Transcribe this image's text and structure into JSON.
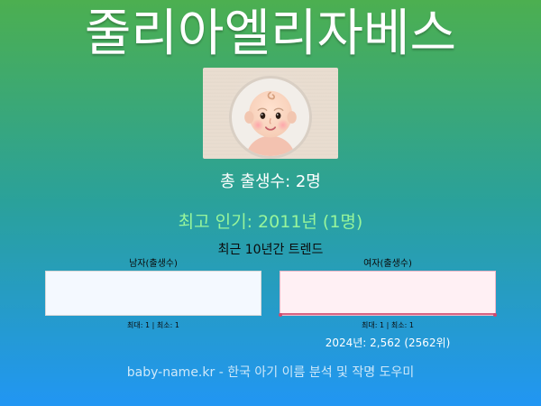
{
  "name": "줄리아엘리자베스",
  "stats": {
    "total_births": "총 출생수: 2명",
    "top_popularity": "최고 인기: 2011년 (1명)"
  },
  "trend": {
    "title": "최근 10년간 트렌드",
    "male": {
      "label": "남자(출생수)",
      "stats": "최대: 1 | 최소: 1",
      "color": "#f4f9ff"
    },
    "female": {
      "label": "여자(출생수)",
      "stats": "최대: 1 | 최소: 1",
      "rank": "2024년: 2,562 (2562위)",
      "color": "#fff0f4",
      "line_color": "#d04b6f"
    }
  },
  "footer": {
    "text": "baby-name.kr - 한국 아기 이름 분석 및 작명 도우미"
  },
  "colors": {
    "background_top": "#4caf50",
    "background_bottom": "#2196f3",
    "highlight_green": "#98f59b"
  },
  "icons": {
    "avatar": "baby-face-icon"
  }
}
